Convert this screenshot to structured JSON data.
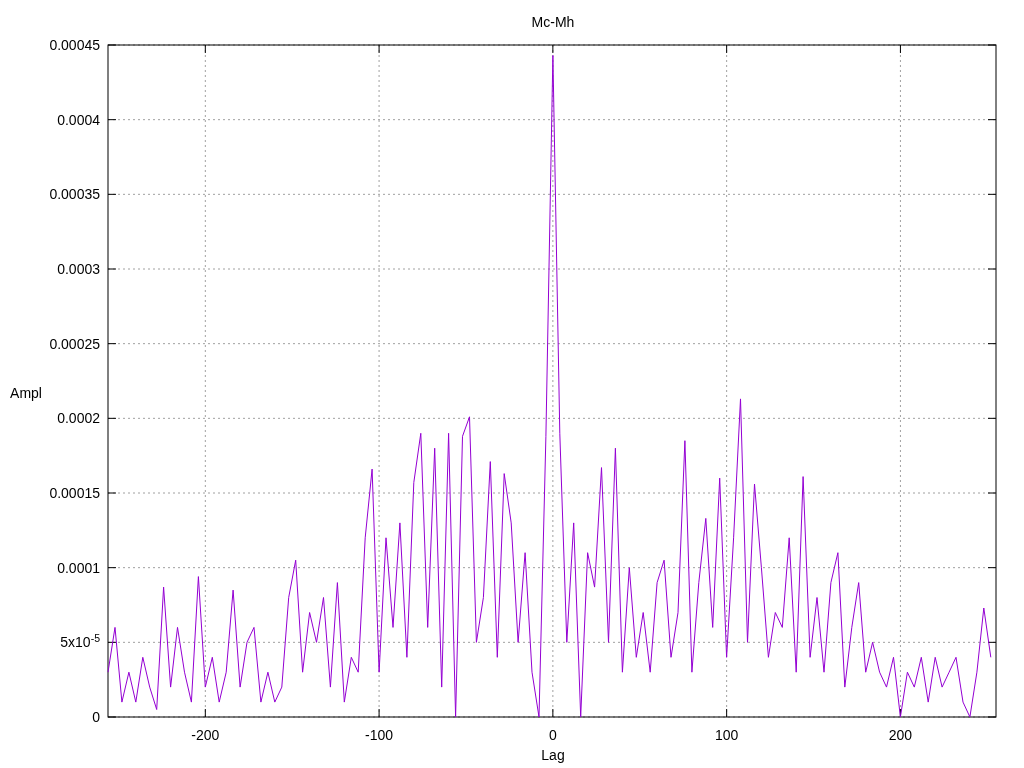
{
  "chart_data": {
    "type": "line",
    "grid": true,
    "title": "Mc-Mh",
    "xlabel": "Lag",
    "ylabel": "Ampl",
    "xlim": [
      -256,
      255
    ],
    "ylim": [
      0,
      0.00045
    ],
    "xticks": [
      -200,
      -100,
      0,
      100,
      200
    ],
    "yticks": [
      {
        "value": 0,
        "label": "0"
      },
      {
        "value": 5e-05,
        "label": "5x10$^{-5}$"
      },
      {
        "value": 0.0001,
        "label": "0.0001"
      },
      {
        "value": 0.00015,
        "label": "0.00015"
      },
      {
        "value": 0.0002,
        "label": "0.0002"
      },
      {
        "value": 0.00025,
        "label": "0.00025"
      },
      {
        "value": 0.0003,
        "label": "0.0003"
      },
      {
        "value": 0.00035,
        "label": "0.00035"
      },
      {
        "value": 0.0004,
        "label": "0.0004"
      },
      {
        "value": 0.00045,
        "label": "0.00045"
      }
    ],
    "x": [
      -256,
      -252,
      -248,
      -244,
      -240,
      -236,
      -232,
      -228,
      -224,
      -220,
      -216,
      -212,
      -208,
      -204,
      -200,
      -196,
      -192,
      -188,
      -184,
      -180,
      -176,
      -172,
      -168,
      -164,
      -160,
      -156,
      -152,
      -148,
      -144,
      -140,
      -136,
      -132,
      -128,
      -124,
      -120,
      -116,
      -112,
      -108,
      -104,
      -100,
      -96,
      -92,
      -88,
      -84,
      -80,
      -76,
      -72,
      -68,
      -64,
      -60,
      -56,
      -52,
      -48,
      -44,
      -40,
      -36,
      -32,
      -28,
      -24,
      -20,
      -16,
      -12,
      -8,
      -4,
      0,
      4,
      8,
      12,
      16,
      20,
      24,
      28,
      32,
      36,
      40,
      44,
      48,
      52,
      56,
      60,
      64,
      68,
      72,
      76,
      80,
      84,
      88,
      92,
      96,
      100,
      104,
      108,
      112,
      116,
      120,
      124,
      128,
      132,
      136,
      140,
      144,
      148,
      152,
      156,
      160,
      164,
      168,
      172,
      176,
      180,
      184,
      188,
      192,
      196,
      200,
      204,
      208,
      212,
      216,
      220,
      224,
      228,
      232,
      236,
      240,
      244,
      248,
      252
    ],
    "series": [
      {
        "color": "#9400d3",
        "values": [
          3e-05,
          6e-05,
          1e-05,
          3e-05,
          1e-05,
          4e-05,
          2e-05,
          5e-06,
          8.7e-05,
          2e-05,
          6e-05,
          3e-05,
          1e-05,
          9.4e-05,
          2e-05,
          4e-05,
          1e-05,
          3e-05,
          8.5e-05,
          2e-05,
          5e-05,
          6e-05,
          1e-05,
          3e-05,
          1e-05,
          2e-05,
          8e-05,
          0.000105,
          3e-05,
          7e-05,
          5e-05,
          8e-05,
          2e-05,
          9e-05,
          1e-05,
          4e-05,
          3e-05,
          0.00012,
          0.000166,
          3e-05,
          0.00012,
          6e-05,
          0.00013,
          4e-05,
          0.000157,
          0.00019,
          6e-05,
          0.00018,
          2e-05,
          0.00019,
          0,
          0.000188,
          0.000201,
          5e-05,
          8e-05,
          0.000171,
          4e-05,
          0.000163,
          0.00013,
          5e-05,
          0.00011,
          3e-05,
          0,
          0.000188,
          0.000443,
          0.00019,
          5e-05,
          0.00013,
          0,
          0.00011,
          8.7e-05,
          0.000167,
          5e-05,
          0.00018,
          3e-05,
          0.0001,
          4e-05,
          7e-05,
          3e-05,
          9e-05,
          0.000105,
          4e-05,
          7e-05,
          0.000185,
          3e-05,
          9e-05,
          0.000133,
          6e-05,
          0.00016,
          4e-05,
          0.00012,
          0.000213,
          5e-05,
          0.000156,
          0.0001,
          4e-05,
          7e-05,
          6e-05,
          0.00012,
          3e-05,
          0.000161,
          4e-05,
          8e-05,
          3e-05,
          9e-05,
          0.00011,
          2e-05,
          6e-05,
          9e-05,
          3e-05,
          5e-05,
          3e-05,
          2e-05,
          4e-05,
          0,
          3e-05,
          2e-05,
          4e-05,
          1e-05,
          4e-05,
          2e-05,
          3e-05,
          4e-05,
          1e-05,
          0,
          3e-05,
          7.3e-05,
          4e-05
        ]
      }
    ]
  }
}
